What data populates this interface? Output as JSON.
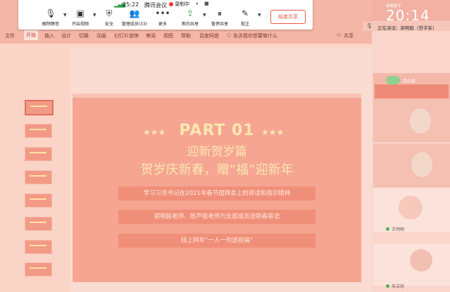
{
  "meeting_toolbar": {
    "status": {
      "time": "25:22",
      "name": "腾讯会议",
      "recording": "录制中"
    },
    "buttons": [
      {
        "label": "解除静音",
        "icon": "mic-muted-icon"
      },
      {
        "label": "开启视频",
        "icon": "video-off-icon"
      },
      {
        "label": "安全",
        "icon": "shield-icon"
      },
      {
        "label": "管理成员(33)",
        "icon": "members-icon"
      },
      {
        "label": "更多",
        "icon": "more-icon"
      },
      {
        "label": "新的共享",
        "icon": "share-icon"
      },
      {
        "label": "暂停共享",
        "icon": "pause-icon"
      },
      {
        "label": "批注",
        "icon": "annotate-icon"
      }
    ],
    "end_share": "结束共享"
  },
  "powerpoint": {
    "menu": [
      "文件",
      "开始",
      "插入",
      "设计",
      "切换",
      "动画",
      "幻灯片放映",
      "审阅",
      "视图",
      "帮助",
      "百度网盘"
    ],
    "active_menu": "开始",
    "tell_me": "告诉我你想要做什么",
    "share": "共享",
    "slide": {
      "part": "PART 01",
      "subtitle": "迎新贺岁篇",
      "title": "贺岁庆新春，赠“福”迎新年",
      "items": [
        "学习习总书记在2021年春节团拜会上的讲话和指示精神",
        "郭明毅老师、陈芦丽老师为支部成员送新春寄语",
        "线上拜年“一人一句送祝福”"
      ]
    }
  },
  "side_panel": {
    "desk_label": "桌面助手",
    "clock": "20:14",
    "speaking": "正在讲话：郭明毅（哲学系）",
    "participants": [
      "吕心如",
      "",
      "",
      "王明翔",
      "朱洁琼"
    ]
  },
  "colors": {
    "accent": "#e35a4a",
    "slide": "#f5a592",
    "gold": "#fbe7b0"
  }
}
